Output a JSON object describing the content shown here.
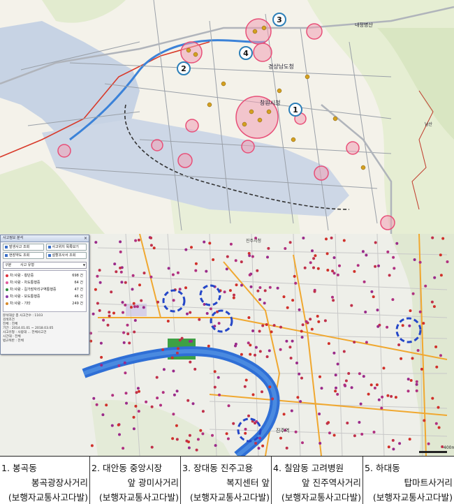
{
  "map_top": {
    "labels": [
      "창원시청",
      "경상남도청",
      "내정병산",
      "남산"
    ],
    "markers": [
      "1",
      "2",
      "3",
      "4"
    ]
  },
  "map_bottom": {
    "panel": {
      "title": "사고정보 분석",
      "buttons": [
        "발생사고 조회",
        "사고위치 목록보기",
        "현장약도 조회",
        "설할조사서 조회"
      ],
      "select_label": "구분",
      "select_value": "사고 유형",
      "rows": [
        {
          "label": "차:사람 - 횡단중",
          "count": "698 건",
          "color": "#e0303a"
        },
        {
          "label": "차:사람 - 차도통행중",
          "count": "64 건",
          "color": "#e05a9c"
        },
        {
          "label": "차:사람 - 길가장자리구역통행중",
          "count": "47 건",
          "color": "#2c8c3c"
        },
        {
          "label": "차:사람 - 보도통행중",
          "count": "46 건",
          "color": "#8b3aa8"
        },
        {
          "label": "차:사람 - 기타",
          "count": "249 건",
          "color": "#d88a2a"
        }
      ],
      "info": [
        "분석대상 총 사고건수 : 1103",
        "검색조건",
        "전체 : 전체",
        "기간 : 2014.01.01 ~ 2018.03.05",
        "사고유형 : 사람대 ... 전체사고건",
        "시간대 : 전체",
        "법규위반 : 전체"
      ]
    },
    "labels": [
      "진주역",
      "진주시청"
    ],
    "scale": "400m"
  },
  "captions": [
    {
      "l1": "1. 봉곡동",
      "l2": "봉곡광장사거리",
      "l3": "(보행자교통사고다발)"
    },
    {
      "l1": "2. 대안동 중앙시장",
      "l2": "앞 광미사거리",
      "l3": "(보행자교통사고다발)"
    },
    {
      "l1": "3. 장대동 진주고용",
      "l2": "복지센터 앞",
      "l3": "(보행자교통사고다발)"
    },
    {
      "l1": "4. 칠암동 고려병원",
      "l2": "앞 진주역사거리",
      "l3": "(보행자교통사고다발)"
    },
    {
      "l1": "5. 하대동",
      "l2": "탑마트사거리",
      "l3": "(보행자교통사고다발)"
    }
  ],
  "colors": {
    "hotspot": "#e84f78",
    "accident": "#d4a020",
    "circle": "#2547c8",
    "river": "#2f6fd6"
  }
}
